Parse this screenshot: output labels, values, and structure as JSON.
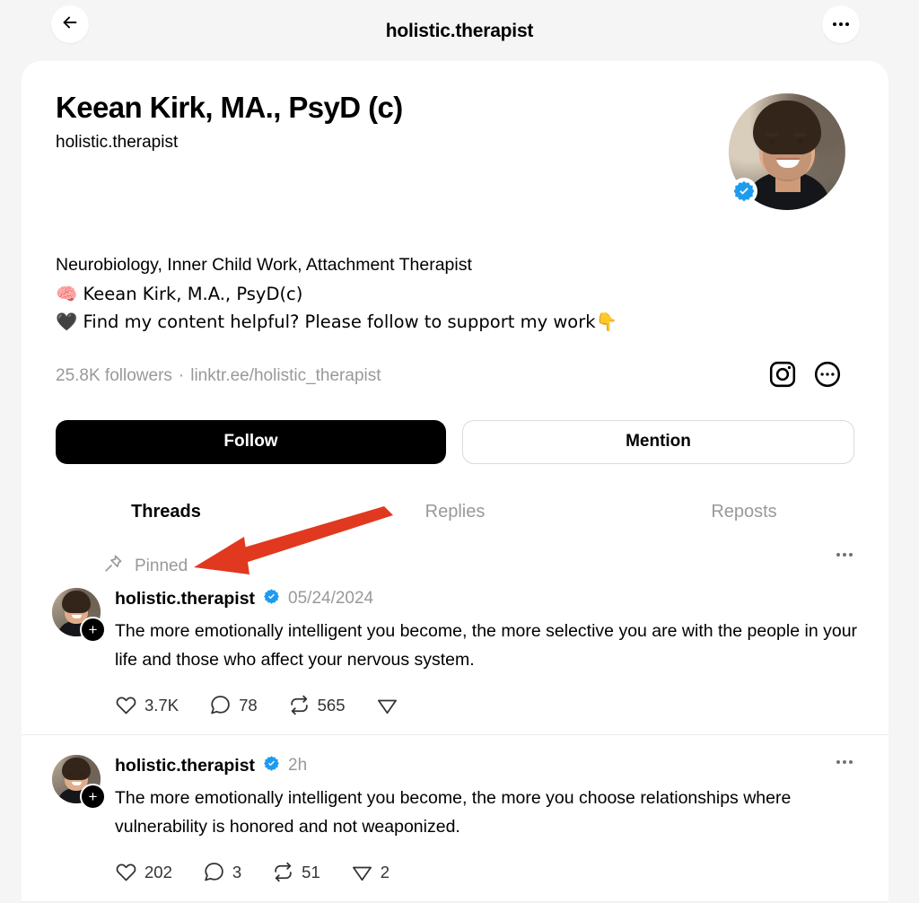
{
  "topbar": {
    "title": "holistic.therapist",
    "back_icon": "arrow-left-icon",
    "more_icon": "more-horizontal-icon"
  },
  "profile": {
    "display_name": "Keean Kirk, MA., PsyD (c)",
    "handle": "holistic.therapist",
    "verified": true,
    "bio_lines": [
      "Neurobiology, Inner Child Work, Attachment Therapist",
      "🧠 Keean Kirk, M.A., PsyD(c)",
      "🖤 Find my content helpful? Please follow to support my work👇"
    ],
    "followers": "25.8K followers",
    "separator": "·",
    "link": "linktr.ee/holistic_therapist",
    "instagram_icon": "instagram-icon",
    "more_icon": "more-circle-icon",
    "follow_button": "Follow",
    "mention_button": "Mention"
  },
  "tabs": [
    {
      "label": "Threads",
      "active": true
    },
    {
      "label": "Replies",
      "active": false
    },
    {
      "label": "Reposts",
      "active": false
    }
  ],
  "posts": [
    {
      "pinned": true,
      "pinned_label": "Pinned",
      "pin_icon": "pin-icon",
      "user": "holistic.therapist",
      "verified": true,
      "time": "05/24/2024",
      "text": "The more emotionally intelligent you become, the more selective you are with the people in your life and those who affect your nervous system.",
      "actions": {
        "likes": "3.7K",
        "comments": "78",
        "reposts": "565",
        "shares": ""
      }
    },
    {
      "pinned": false,
      "user": "holistic.therapist",
      "verified": true,
      "time": "2h",
      "text": "The more emotionally intelligent you become, the more you choose relationships where vulnerability is honored and not weaponized.",
      "actions": {
        "likes": "202",
        "comments": "3",
        "reposts": "51",
        "shares": "2"
      }
    }
  ],
  "annotation": {
    "type": "arrow",
    "color": "#E0391F",
    "points_at": "pinned-label"
  },
  "colors": {
    "page_background": "#f5f5f5",
    "card_background": "#ffffff",
    "accent_verified": "#1d9bf0",
    "muted_text": "#999999",
    "primary_button": "#000000",
    "annotation_red": "#E0391F"
  }
}
